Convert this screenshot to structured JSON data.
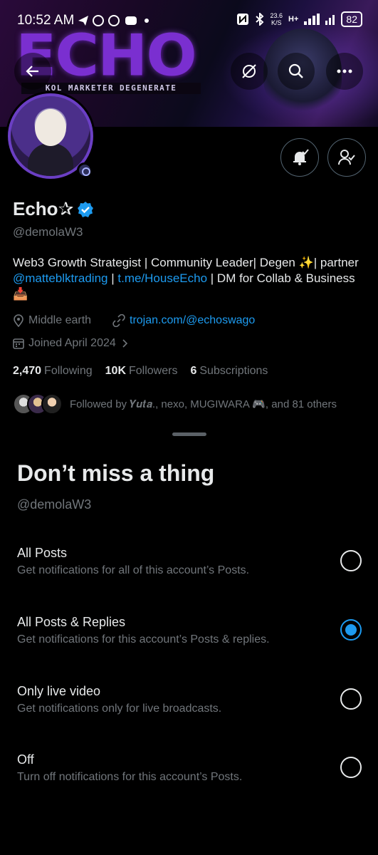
{
  "status_bar": {
    "time": "10:52 AM",
    "left_icons": "◢ ◯ ◯ ◉ •",
    "net_speed_value": "23.6",
    "net_speed_unit": "K/S",
    "network_label": "H+",
    "battery": "82"
  },
  "banner": {
    "title": "ECHO",
    "subtitle": "KOL MARKETER DEGENERATE"
  },
  "profile": {
    "display_name": "Echo✰",
    "handle": "@demolaW3",
    "bio_part1": "Web3 Growth Strategist | Community Leader| Degen ✨| partner ",
    "bio_link1": "@matteblktrading",
    "bio_sep": " | ",
    "bio_link2": "t.me/HouseEcho",
    "bio_part2": " | DM for Collab & Business 📥",
    "location": "Middle earth",
    "website": "trojan.com/@echoswago",
    "joined": "Joined April 2024",
    "following_count": "2,470",
    "following_label": "Following",
    "followers_count": "10K",
    "followers_label": "Followers",
    "subscriptions_count": "6",
    "subscriptions_label": "Subscriptions",
    "followed_by": "Followed by 𝒀𝒖𝒕𝒂., nexo, MUGIWARA 🎮, and 81 others"
  },
  "sheet": {
    "title": "Don’t miss a thing",
    "handle": "@demolaW3",
    "options": [
      {
        "title": "All Posts",
        "desc": "Get notifications for all of this account’s Posts.",
        "selected": false
      },
      {
        "title": "All Posts & Replies",
        "desc": "Get notifications for this account’s Posts & replies.",
        "selected": true
      },
      {
        "title": "Only live video",
        "desc": "Get notifications only for live broadcasts.",
        "selected": false
      },
      {
        "title": "Off",
        "desc": "Turn off notifications for this account’s Posts.",
        "selected": false
      }
    ]
  },
  "colors": {
    "accent": "#1d9bf0",
    "secondary_text": "#71767b",
    "primary_text": "#e7e9ea",
    "background": "#000000"
  }
}
